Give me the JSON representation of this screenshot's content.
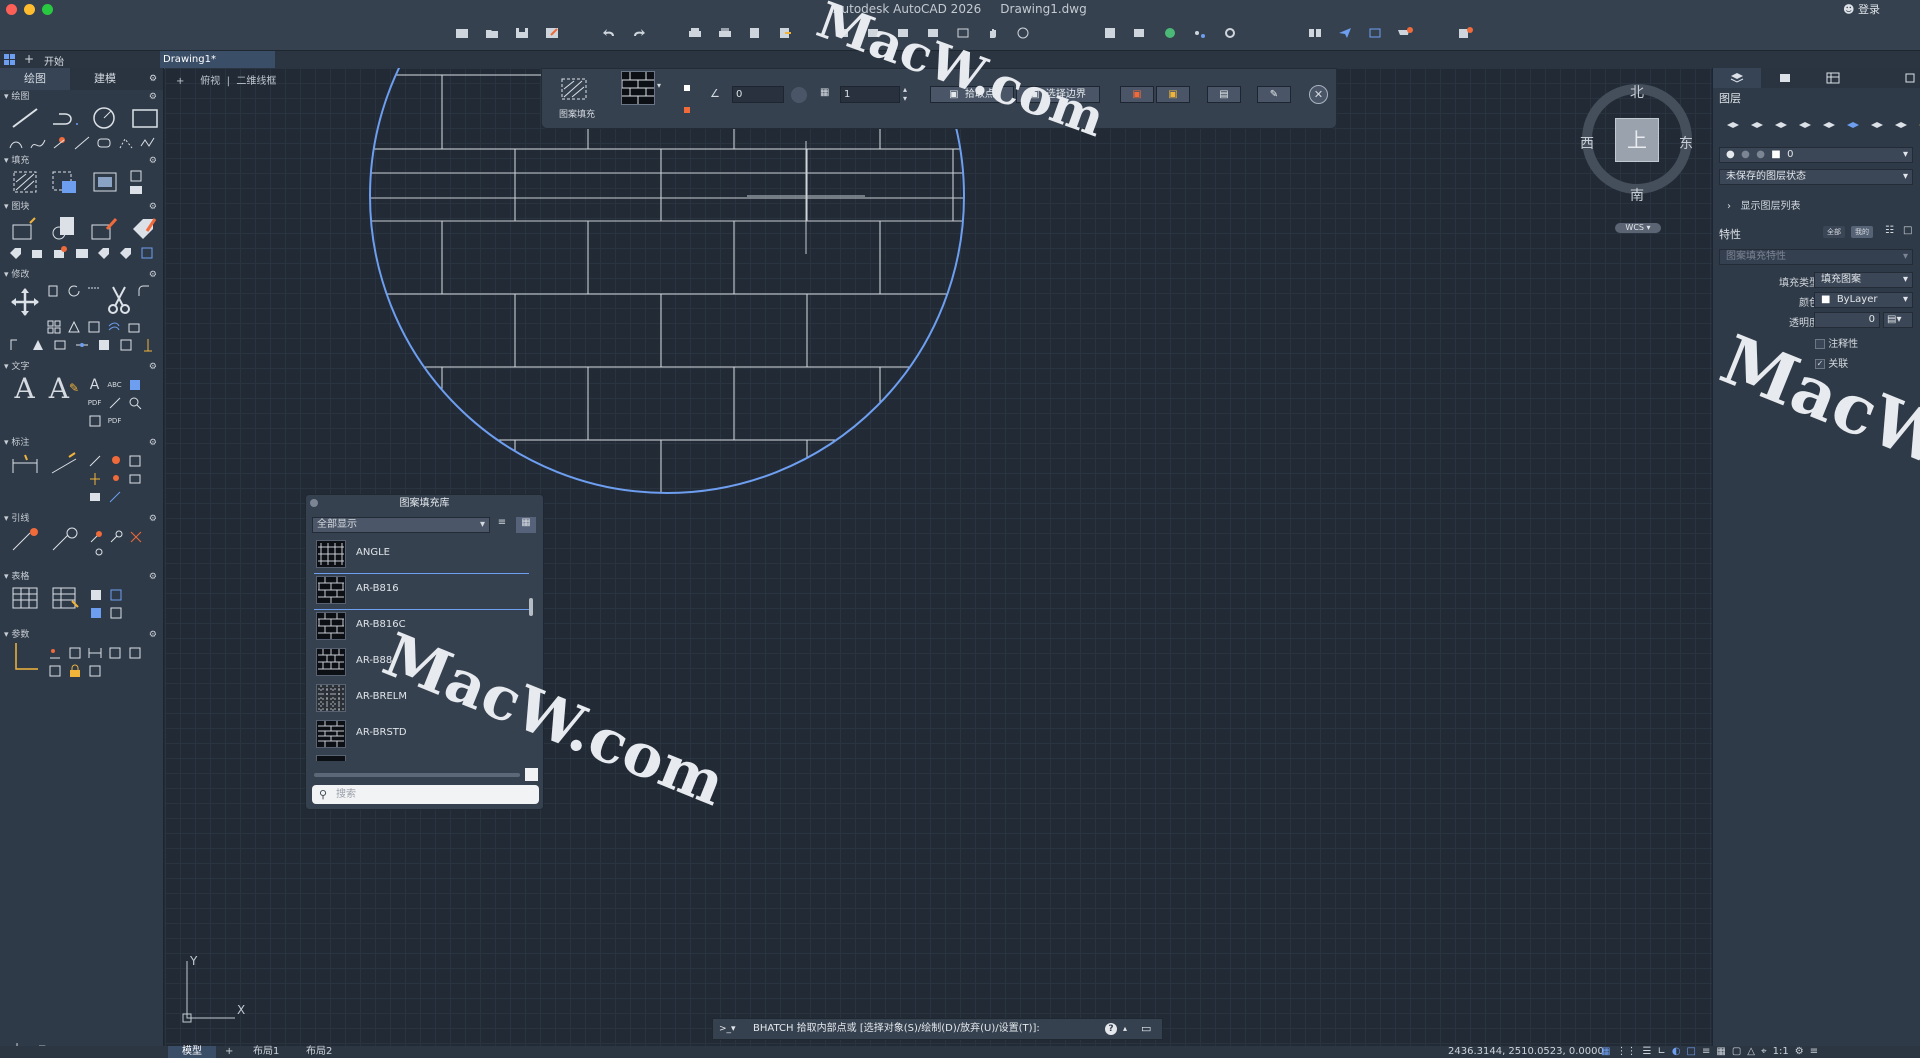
{
  "window": {
    "app_title": "Autodesk AutoCAD 2026",
    "doc_title": "Drawing1.dwg",
    "login": "登录"
  },
  "tabs": {
    "start": "开始",
    "doc": "Drawing1*"
  },
  "left_panel": {
    "tabs": [
      "绘图",
      "建模"
    ],
    "sections": [
      "绘图",
      "填充",
      "图块",
      "修改",
      "文字",
      "标注",
      "引线",
      "表格",
      "参数"
    ]
  },
  "viewport": {
    "view": "俯视",
    "style": "二维线框"
  },
  "hatch_toolbar": {
    "label": "图案填充",
    "angle": "0",
    "scale": "1",
    "pick_points": "拾取点",
    "select_boundary": "选择边界"
  },
  "viewcube": {
    "north": "北",
    "south": "南",
    "east": "东",
    "west": "西",
    "top": "上",
    "wcs": "WCS"
  },
  "right_panel": {
    "layers_title": "图层",
    "layer_name": "0",
    "layer_state": "未保存的图层状态",
    "show_layer_list": "显示图层列表",
    "properties_title": "特性",
    "filter_all": "全部",
    "filter_mine": "我的",
    "context": "图案填充特性",
    "fill_type_label": "填充类型",
    "fill_type_value": "填充图案",
    "color_label": "颜色",
    "color_value": "ByLayer",
    "transparency_label": "透明度",
    "transparency_value": "0",
    "annotative_label": "注释性",
    "associative_label": "关联"
  },
  "hatch_library": {
    "title": "图案填充库",
    "filter": "全部显示",
    "items": [
      "ANGLE",
      "AR-B816",
      "AR-B816C",
      "AR-B88",
      "AR-BRELM",
      "AR-BRSTD"
    ],
    "search_placeholder": "搜索"
  },
  "command_line": {
    "prompt": "BHATCH 拾取内部点或 [选择对象(S)/绘制(D)/放弃(U)/设置(T)]:"
  },
  "status": {
    "coordinates": "2436.3144, 2510.0523, 0.0000",
    "model": "模型",
    "layout1": "布局1",
    "layout2": "布局2",
    "scale": "1:1"
  },
  "ucs": {
    "x": "X",
    "y": "Y"
  },
  "watermarks": [
    "MacW.com",
    "MacW.com",
    "MacW.com"
  ],
  "colors": {
    "accent_blue": "#6e9ef0",
    "notify_orange": "#f06a3a",
    "traffic_red": "#fe5f57",
    "traffic_yellow": "#febc2e",
    "traffic_green": "#28c840"
  }
}
